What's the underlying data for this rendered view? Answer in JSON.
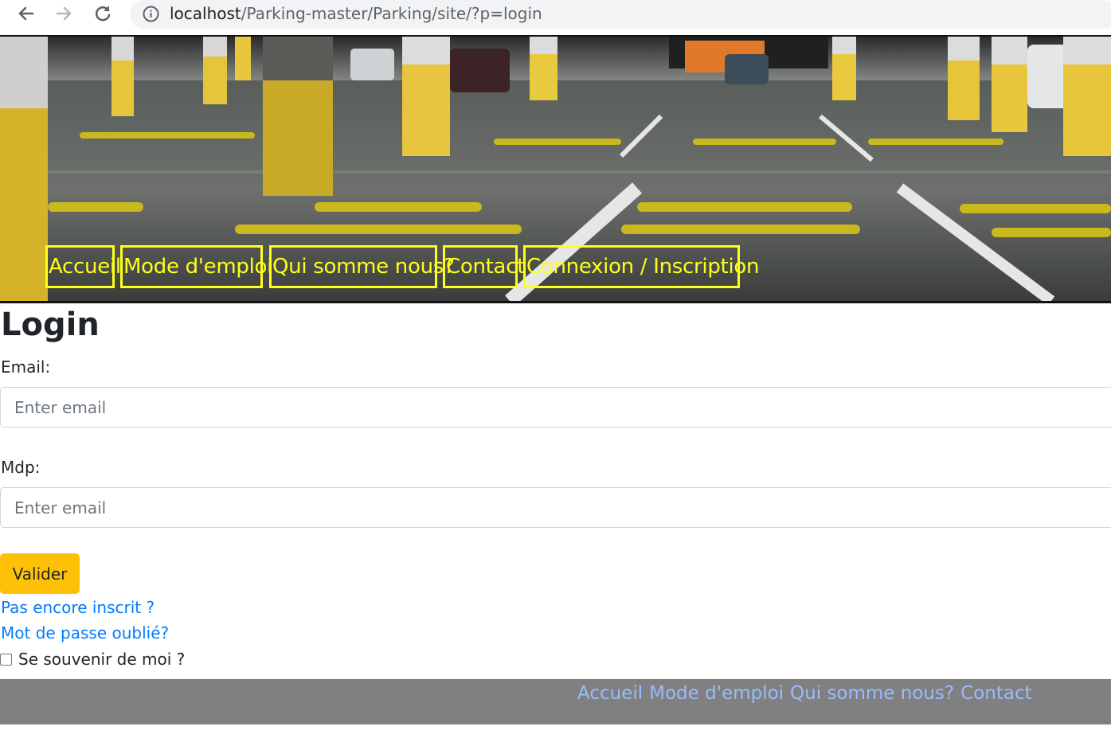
{
  "browser": {
    "url_host": "localhost",
    "url_path": "/Parking-master/Parking/site/?p=login"
  },
  "nav": {
    "items": [
      {
        "label": "Accueil"
      },
      {
        "label": "Mode d'emploi"
      },
      {
        "label": "Qui somme nous?"
      },
      {
        "label": "Contact"
      },
      {
        "label": "Connexion / Inscription"
      }
    ]
  },
  "main": {
    "title": "Login",
    "email_label": "Email:",
    "email_placeholder": "Enter email",
    "password_label": "Mdp:",
    "password_placeholder": "Enter email",
    "submit_label": "Valider",
    "register_link": "Pas encore inscrit ?",
    "forgot_link": "Mot de passe oublié?",
    "remember_label": "Se souvenir de moi ?"
  },
  "footer": {
    "links": [
      "Accueil",
      "Mode d'emploi",
      "Qui somme nous?",
      "Contact"
    ]
  },
  "colors": {
    "nav_accent": "#ffff1a",
    "button": "#ffc107",
    "link": "#007bff",
    "footer_bg": "#808080",
    "footer_link": "#99bbff"
  }
}
